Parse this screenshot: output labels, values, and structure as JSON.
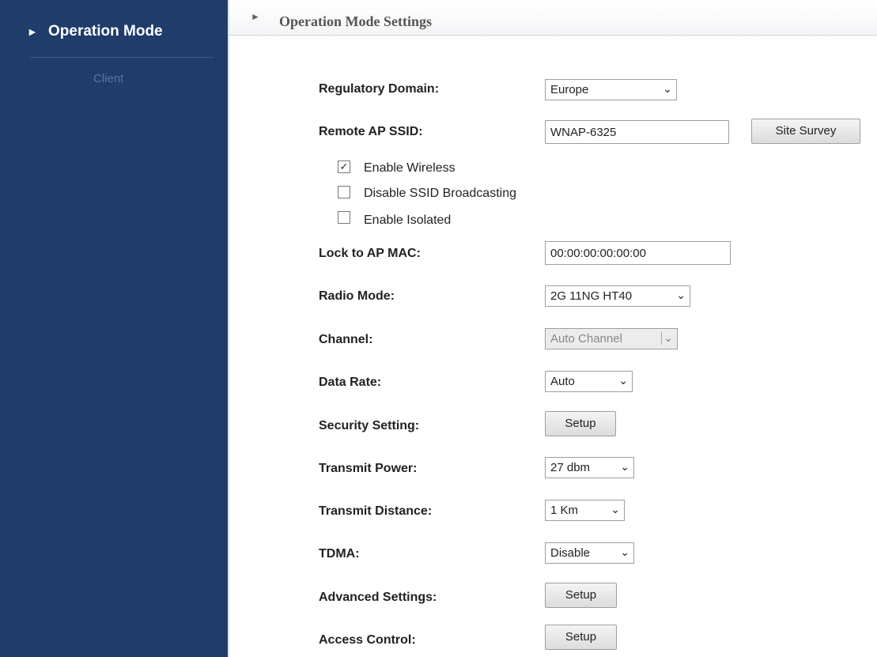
{
  "sidebar": {
    "active_item": "Operation Mode",
    "sub_item": "Client"
  },
  "header": {
    "title": "Operation Mode Settings"
  },
  "form": {
    "regulatory_domain": {
      "label": "Regulatory Domain:",
      "value": "Europe"
    },
    "remote_ap_ssid": {
      "label": "Remote AP SSID:",
      "value": "WNAP-6325",
      "button": "Site Survey"
    },
    "checkboxes": [
      {
        "label": "Enable Wireless",
        "checked": true
      },
      {
        "label": "Disable SSID Broadcasting",
        "checked": false
      },
      {
        "label": "Enable Isolated",
        "checked": false
      }
    ],
    "lock_to_ap_mac": {
      "label": "Lock to AP MAC:",
      "value": "00:00:00:00:00:00"
    },
    "radio_mode": {
      "label": "Radio Mode:",
      "value": "2G 11NG HT40"
    },
    "channel": {
      "label": "Channel:",
      "value": "Auto Channel"
    },
    "data_rate": {
      "label": "Data Rate:",
      "value": "Auto"
    },
    "security_setting": {
      "label": "Security Setting:",
      "button": "Setup"
    },
    "transmit_power": {
      "label": "Transmit Power:",
      "value": "27 dbm"
    },
    "transmit_distance": {
      "label": "Transmit Distance:",
      "value": "1 Km"
    },
    "tdma": {
      "label": "TDMA:",
      "value": "Disable"
    },
    "advanced_settings": {
      "label": "Advanced Settings:",
      "button": "Setup"
    },
    "access_control": {
      "label": "Access Control:",
      "button": "Setup"
    }
  }
}
